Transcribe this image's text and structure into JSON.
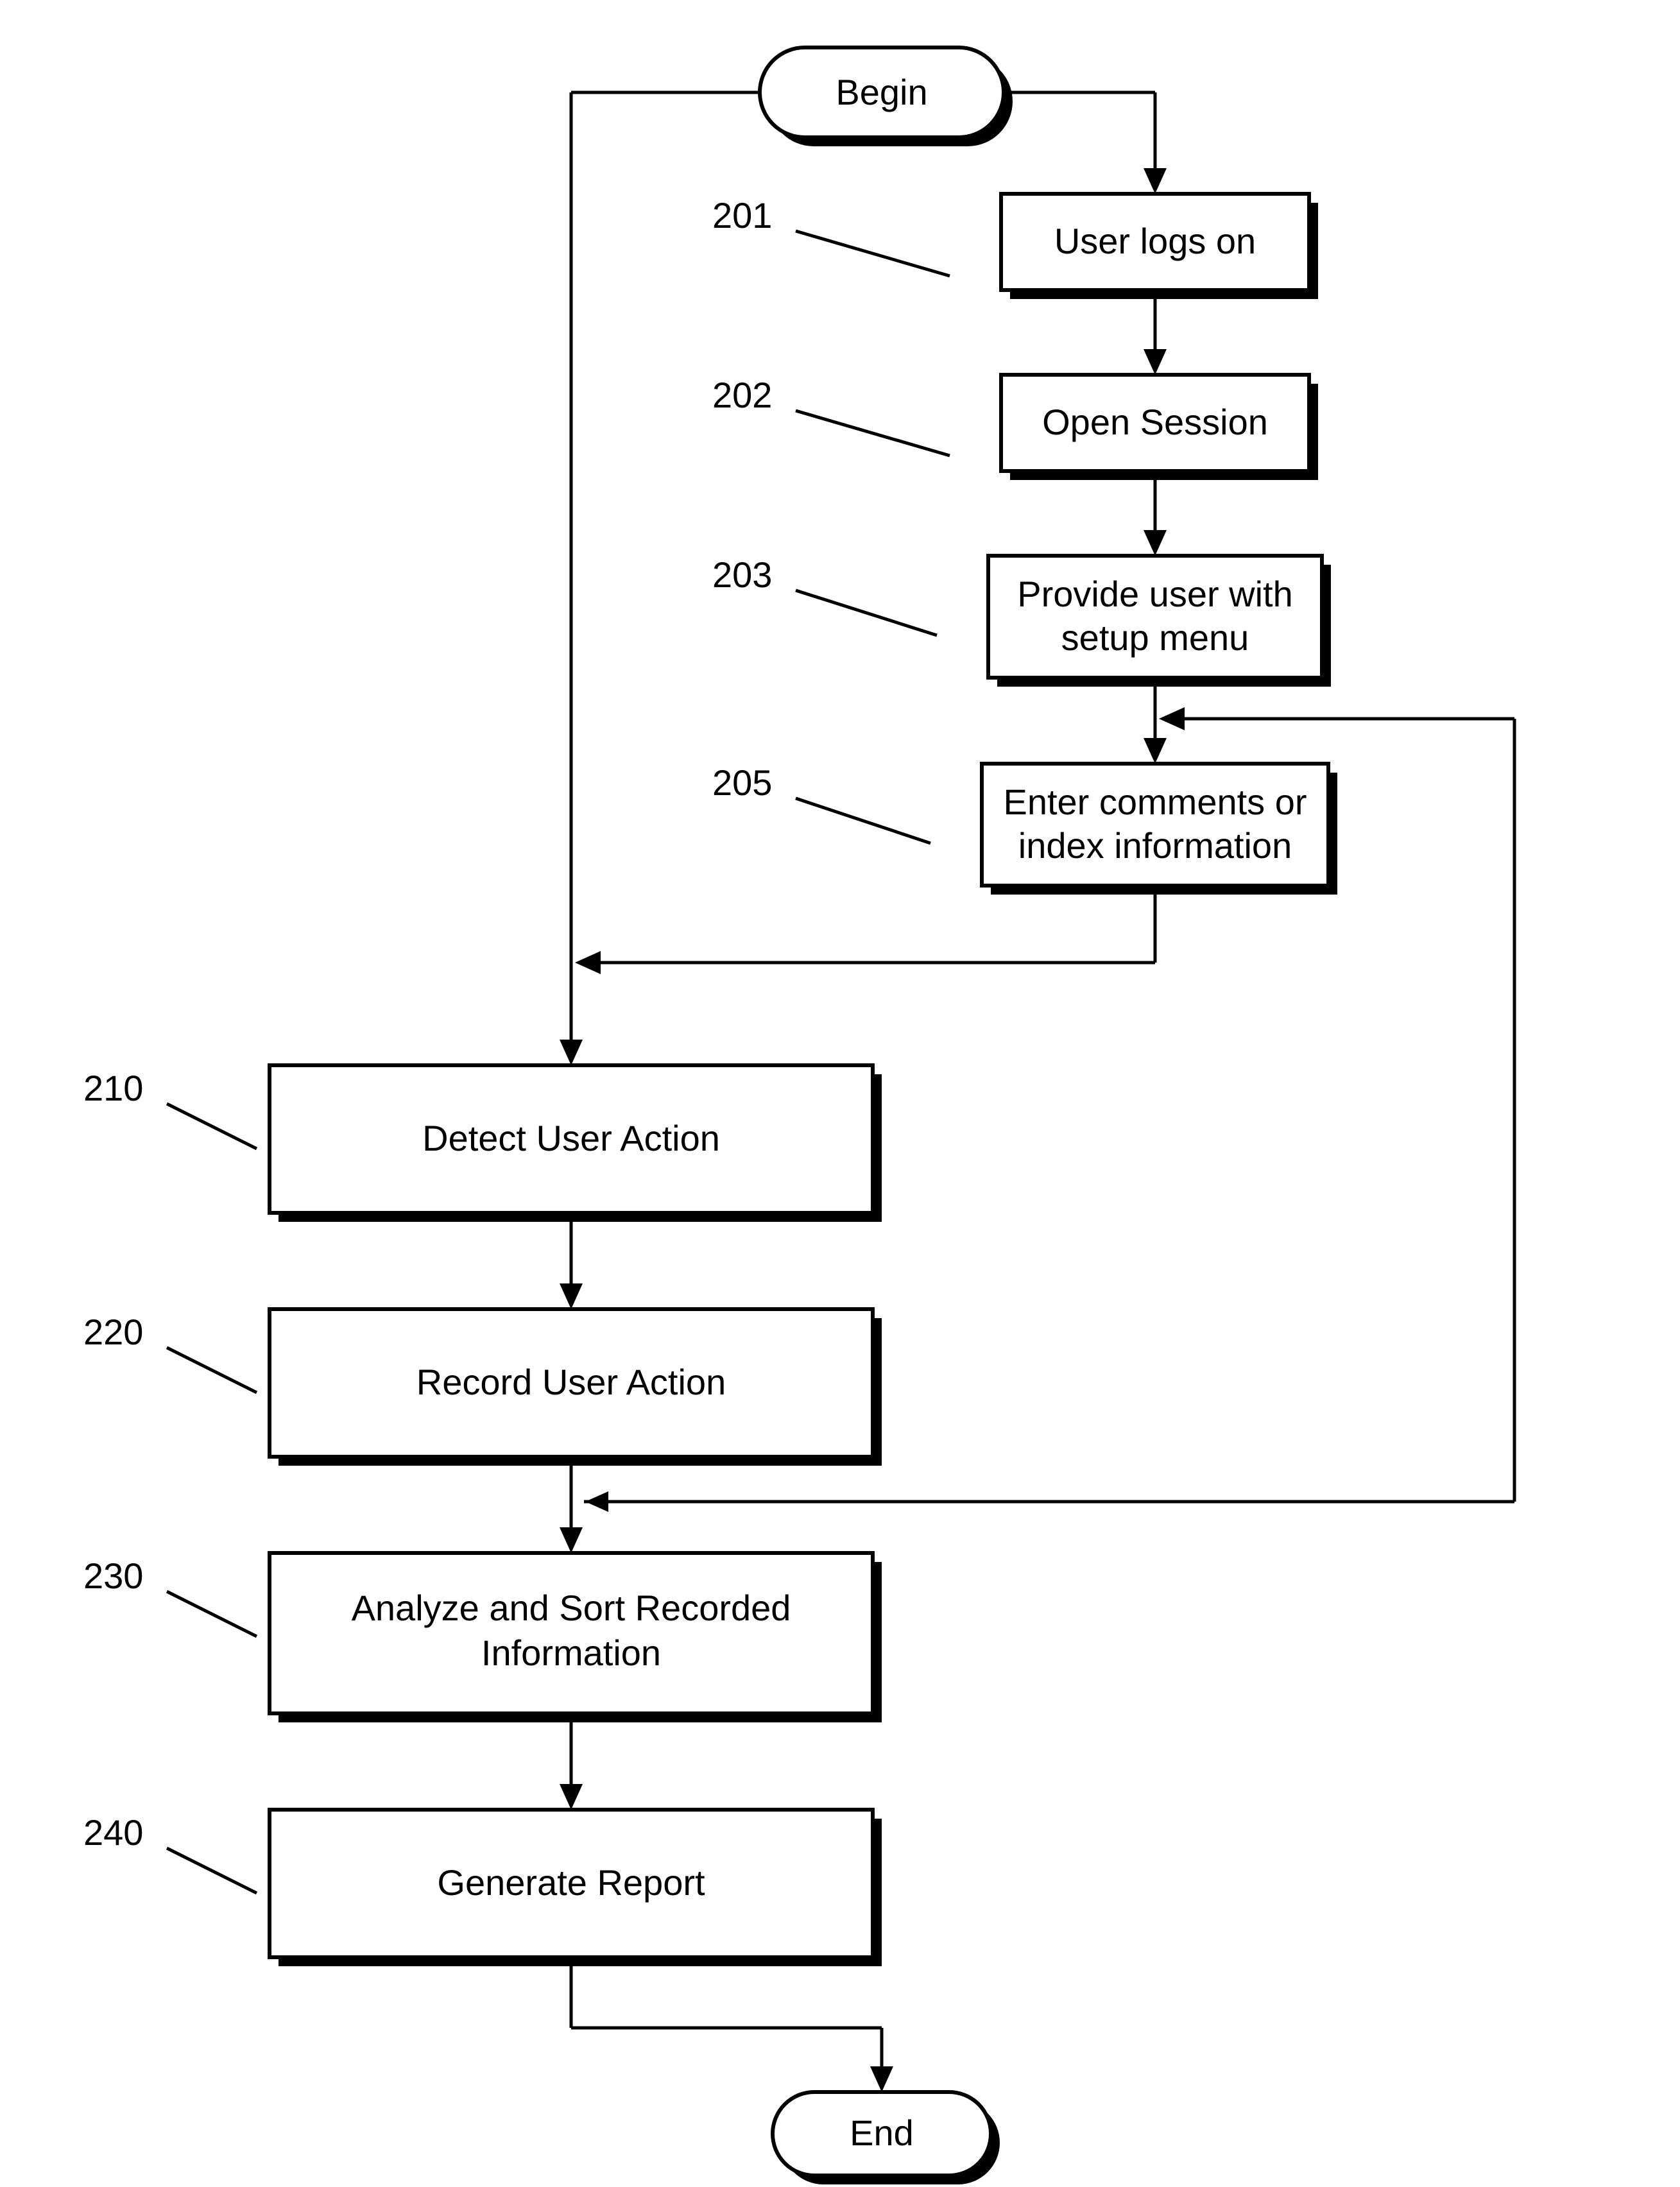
{
  "nodes": {
    "begin": {
      "label": "Begin"
    },
    "end": {
      "label": "End"
    },
    "n201": {
      "ref": "201",
      "label": "User logs on"
    },
    "n202": {
      "ref": "202",
      "label": "Open Session"
    },
    "n203": {
      "ref": "203",
      "label1": "Provide user with",
      "label2": "setup menu"
    },
    "n205": {
      "ref": "205",
      "label1": "Enter comments or",
      "label2": "index information"
    },
    "n210": {
      "ref": "210",
      "label": "Detect User Action"
    },
    "n220": {
      "ref": "220",
      "label": "Record User Action"
    },
    "n230": {
      "ref": "230",
      "label1": "Analyze and Sort Recorded",
      "label2": "Information"
    },
    "n240": {
      "ref": "240",
      "label": "Generate Report"
    }
  }
}
